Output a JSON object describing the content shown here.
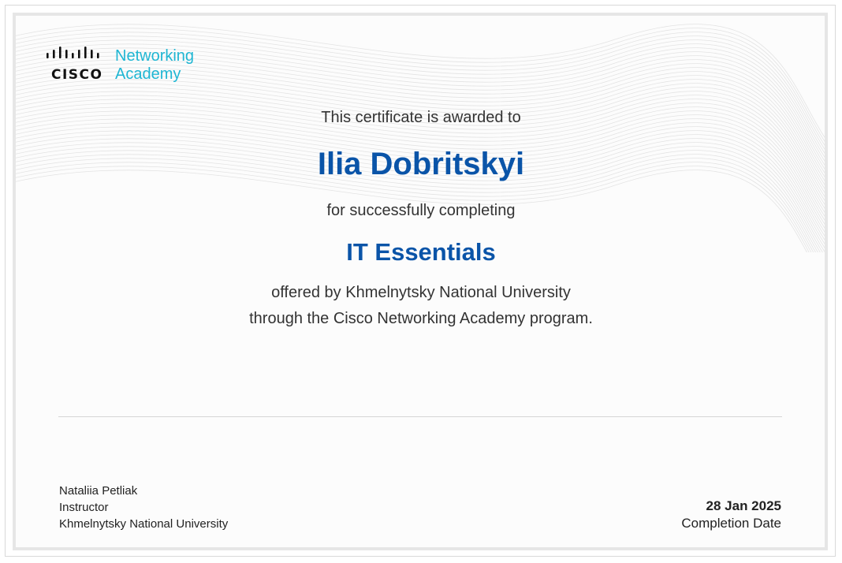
{
  "logo": {
    "brand": "CISCO",
    "line1": "Networking",
    "line2": "Academy",
    "icon": "cisco-bridge-icon",
    "accent_color": "#1fb6d3"
  },
  "certificate": {
    "awarded_text": "This certificate is awarded to",
    "recipient_name": "Ilia Dobritskyi",
    "completing_text": "for successfully completing",
    "course_name": "IT Essentials",
    "offered_line1": "offered by Khmelnytsky National University",
    "offered_line2": "through the Cisco Networking Academy program.",
    "highlight_color": "#0a54a8"
  },
  "instructor": {
    "name": "Nataliia Petliak",
    "role": "Instructor",
    "organization": "Khmelnytsky National University"
  },
  "completion": {
    "date": "28 Jan 2025",
    "label": "Completion Date"
  }
}
